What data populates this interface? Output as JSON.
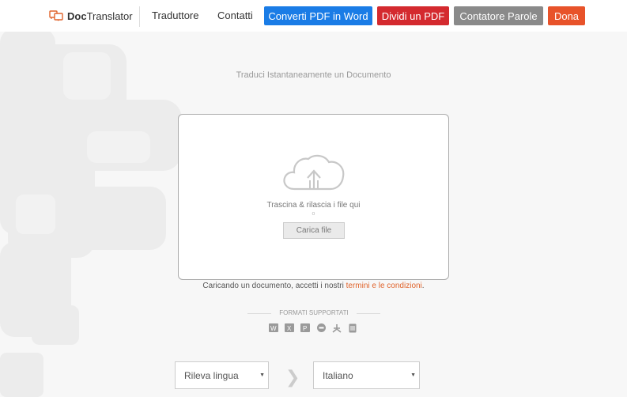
{
  "header": {
    "logo_bold": "Doc",
    "logo_rest": "Translator",
    "nav": [
      "Traduttore",
      "Contatti"
    ],
    "buttons": [
      {
        "label": "Converti PDF in Word",
        "color": "#1a7ce6"
      },
      {
        "label": "Dividi un PDF",
        "color": "#d42a2f"
      },
      {
        "label": "Contatore Parole",
        "color": "#8a8a8a"
      },
      {
        "label": "Dona",
        "color": "#e8532a"
      }
    ]
  },
  "subtitle": "Traduci Istantaneamente un Documento",
  "dropzone": {
    "drop_text": "Trascina & rilascia i file qui",
    "or_text": "o",
    "upload_label": "Carica file"
  },
  "terms": {
    "prefix": "Caricando un documento, accetti i nostri ",
    "link": "termini e le condizioni",
    "suffix": "."
  },
  "formats": {
    "label": "FORMATI SUPPORTATI",
    "icons": [
      "word-icon",
      "excel-icon",
      "powerpoint-icon",
      "opendocument-icon",
      "pdf-icon",
      "text-file-icon"
    ]
  },
  "languages": {
    "source": "Rileva lingua",
    "target": "Italiano"
  }
}
